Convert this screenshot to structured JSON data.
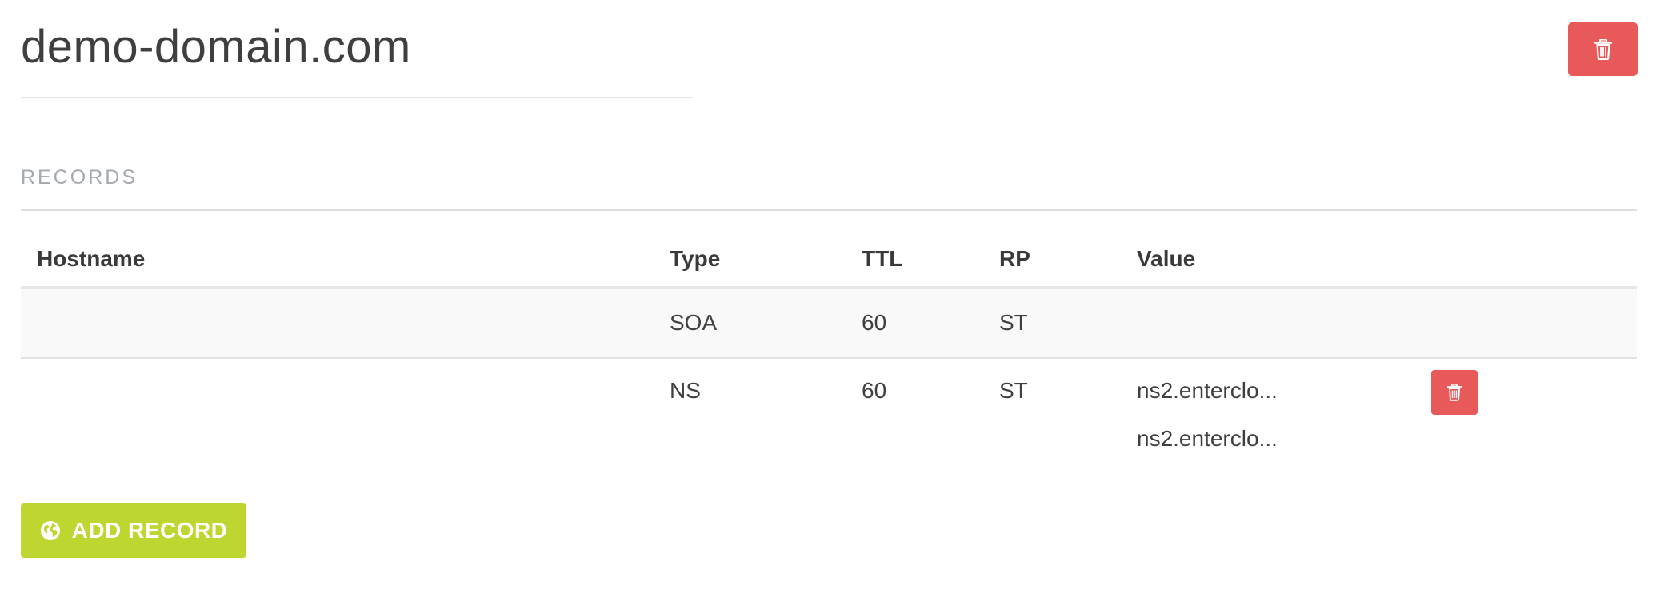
{
  "domain": {
    "name": "demo-domain.com"
  },
  "records": {
    "section_label": "RECORDS",
    "columns": [
      "Hostname",
      "Type",
      "TTL",
      "RP",
      "Value"
    ],
    "rows": [
      {
        "hostname": "",
        "type": "SOA",
        "ttl": "60",
        "rp": "ST",
        "values": []
      },
      {
        "hostname": "",
        "type": "NS",
        "ttl": "60",
        "rp": "ST",
        "values": [
          "ns2.enterclo...",
          "ns2.enterclo..."
        ]
      }
    ]
  },
  "actions": {
    "add_record_label": "ADD RECORD"
  },
  "icons": {
    "delete": "trash-icon",
    "add_record": "globe-icon"
  },
  "colors": {
    "danger": "#e85a5a",
    "primary_green": "#bfd630",
    "muted_label": "#a4a8b0"
  }
}
